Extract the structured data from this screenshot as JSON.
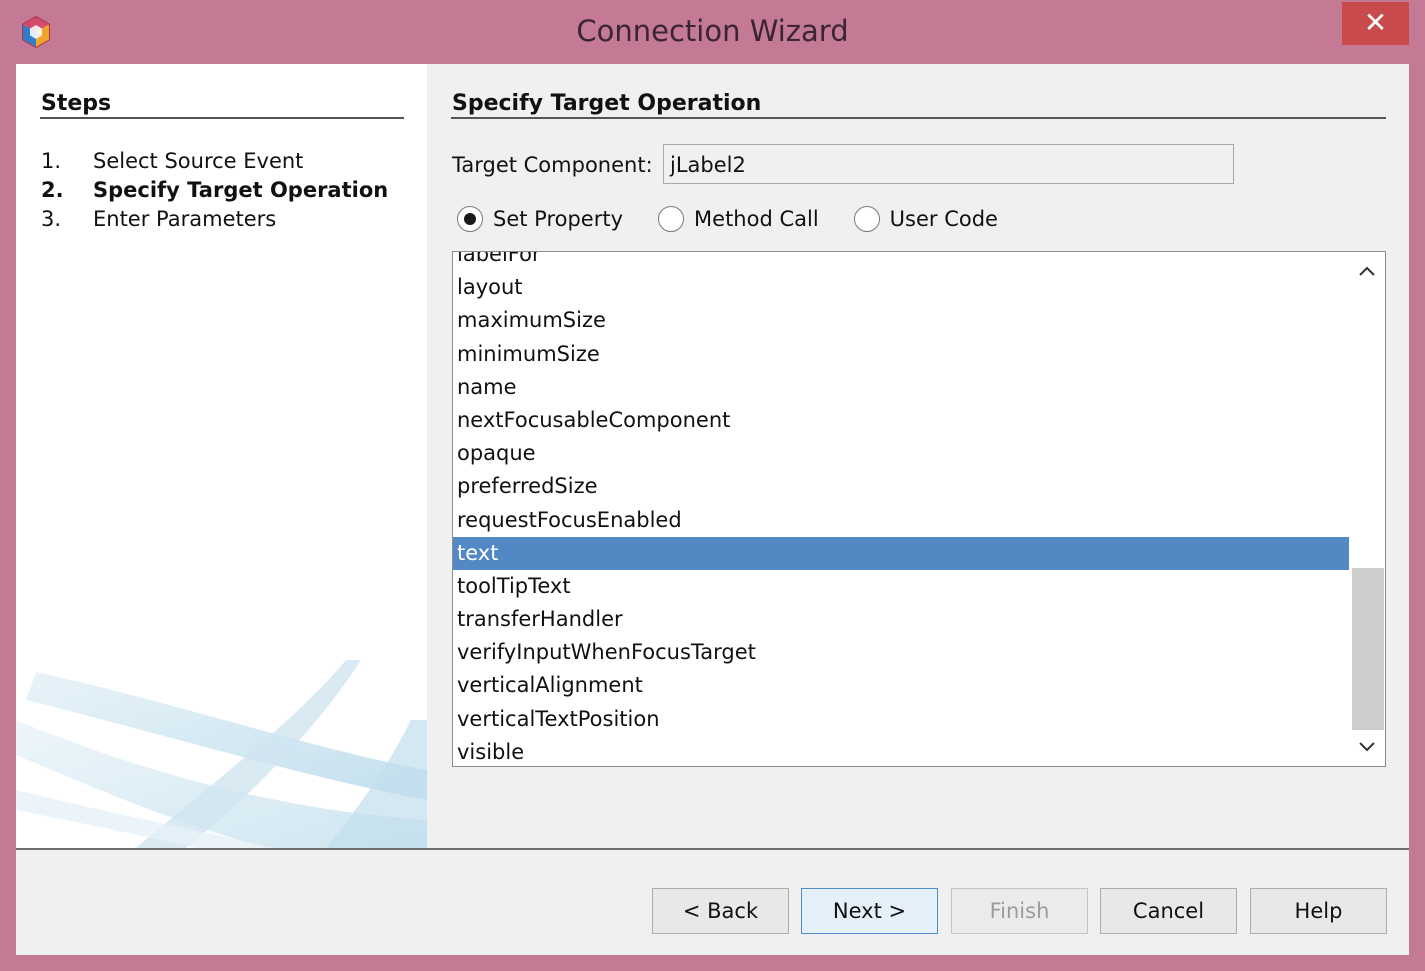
{
  "window": {
    "title": "Connection Wizard",
    "close_glyph": "✕"
  },
  "steps": {
    "title": "Steps",
    "items": [
      {
        "num": "1.",
        "label": "Select Source Event",
        "current": false
      },
      {
        "num": "2.",
        "label": "Specify Target Operation",
        "current": true
      },
      {
        "num": "3.",
        "label": "Enter Parameters",
        "current": false
      }
    ]
  },
  "main": {
    "title": "Specify Target Operation",
    "target_label": "Target Component:",
    "target_value": "jLabel2",
    "radios": [
      {
        "label": "Set Property",
        "checked": true
      },
      {
        "label": "Method Call",
        "checked": false
      },
      {
        "label": "User Code",
        "checked": false
      }
    ],
    "properties": [
      "labelFor",
      "layout",
      "maximumSize",
      "minimumSize",
      "name",
      "nextFocusableComponent",
      "opaque",
      "preferredSize",
      "requestFocusEnabled",
      "text",
      "toolTipText",
      "transferHandler",
      "verifyInputWhenFocusTarget",
      "verticalAlignment",
      "verticalTextPosition",
      "visible"
    ],
    "selected_property": "text",
    "scroll_up_icon": "chevron-up-icon",
    "scroll_down_icon": "chevron-down-icon"
  },
  "buttons": {
    "back": "< Back",
    "next": "Next >",
    "finish": "Finish",
    "cancel": "Cancel",
    "help": "Help"
  },
  "colors": {
    "frame": "#c47a95",
    "selection": "#5289c4",
    "close": "#c94a4a"
  }
}
